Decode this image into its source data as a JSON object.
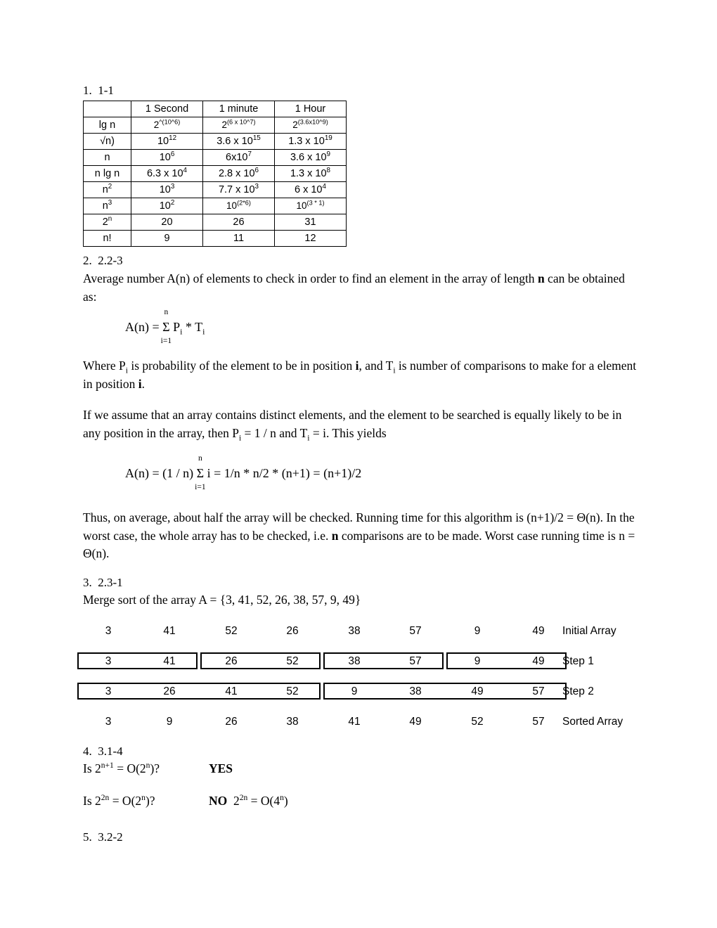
{
  "document": {
    "title_sections": [
      "1.  1-1",
      "2.  2.2-3",
      "3.  2.3-1",
      "4.  3.1-4",
      "5.  3.2-2"
    ]
  },
  "problem1": {
    "heading": "1.  1-1",
    "table": {
      "columns": [
        "",
        "1 Second",
        "1 minute",
        "1 Hour"
      ],
      "rows": [
        {
          "label": "lg n",
          "cells": [
            {
              "base": "2",
              "sup": "^(10^6)",
              "small": true
            },
            {
              "base": "2",
              "sup": "(6 x 10^7)",
              "small": true
            },
            {
              "base": "2",
              "sup": "(3.6x10^9)",
              "small": true
            }
          ]
        },
        {
          "label": "√n)",
          "cells": [
            {
              "base": "10",
              "sup": "12"
            },
            {
              "base": "3.6 x 10",
              "sup": "15"
            },
            {
              "base": "1.3 x 10",
              "sup": "19"
            }
          ]
        },
        {
          "label": "n",
          "cells": [
            {
              "base": "10",
              "sup": "6"
            },
            {
              "base": "6x10",
              "sup": "7"
            },
            {
              "base": "3.6 x 10",
              "sup": "9"
            }
          ]
        },
        {
          "label": "n lg n",
          "cells": [
            {
              "base": "6.3 x 10",
              "sup": "4"
            },
            {
              "base": "2.8 x 10",
              "sup": "6"
            },
            {
              "base": "1.3 x 10",
              "sup": "8"
            }
          ]
        },
        {
          "label": "n²",
          "label_base": "n",
          "label_sup": "2",
          "cells": [
            {
              "base": "10",
              "sup": "3"
            },
            {
              "base": "7.7 x 10",
              "sup": "3"
            },
            {
              "base": "6 x 10",
              "sup": "4"
            }
          ]
        },
        {
          "label": "n³",
          "label_base": "n",
          "label_sup": "3",
          "cells": [
            {
              "base": "10",
              "sup": "2"
            },
            {
              "base": "10",
              "sup": "(2*6)",
              "small": true
            },
            {
              "base": "10",
              "sup": "(3 * 1)",
              "small": true
            }
          ]
        },
        {
          "label": "2ⁿ",
          "label_base": "2",
          "label_sup": "n",
          "cells": [
            {
              "base": "20",
              "sup": ""
            },
            {
              "base": "26",
              "sup": ""
            },
            {
              "base": "31",
              "sup": ""
            }
          ]
        },
        {
          "label": "n!",
          "cells": [
            {
              "base": "9",
              "sup": ""
            },
            {
              "base": "11",
              "sup": ""
            },
            {
              "base": "12",
              "sup": ""
            }
          ]
        }
      ]
    }
  },
  "problem2": {
    "heading": "2.  2.2-3",
    "para1_a": "Average number A(n) of elements to check in order to find an element in the array of length ",
    "para1_bold": "n",
    "para1_b": " can be obtained as:",
    "formula1": {
      "lead": "A(n) = ",
      "sigma": "Σ",
      "upper": "n",
      "lower": "i=1",
      "tail": " P",
      "tail_sub": "i",
      "tail2": " * T",
      "tail2_sub": "i"
    },
    "para2_a": "Where P",
    "para2_sub1": "i",
    "para2_b": " is probability of the element to be in position ",
    "para2_bold1": "i",
    "para2_c": ", and T",
    "para2_sub2": "i",
    "para2_d": " is number of comparisons to make for a element in position ",
    "para2_bold2": "i",
    "para2_e": ".",
    "para3_a": "If we assume that an array contains distinct elements, and the element to be searched is equally likely to be in any position in the array, then P",
    "para3_sub1": "i",
    "para3_b": " = 1 / n and T",
    "para3_sub2": "i",
    "para3_c": " = i.  This yields",
    "formula2": {
      "lead": "A(n) = (1 / n) ",
      "sigma": "Σ",
      "upper": "n",
      "lower": "i=1",
      "tail": " i = 1/n * n/2 * (n+1) = (n+1)/2"
    },
    "para4_a": "Thus, on average, about half the array will be checked. Running time for this algorithm is (n+1)/2 = Θ(n). In the worst case, the whole array has to be checked, i.e. ",
    "para4_bold": "n",
    "para4_b": " comparisons are to be made. Worst case running time is n = Θ(n)."
  },
  "problem3": {
    "heading": "3.  2.3-1",
    "subtitle": "Merge sort of the array A = {3, 41, 52, 26, 38, 57, 9, 49}",
    "rows": [
      {
        "label": "Initial Array",
        "values": [
          "3",
          "41",
          "52",
          "26",
          "38",
          "57",
          "9",
          "49"
        ],
        "boxes": []
      },
      {
        "label": "Step 1",
        "values": [
          "3",
          "41",
          "26",
          "52",
          "38",
          "57",
          "9",
          "49"
        ],
        "boxes": [
          {
            "start": 0,
            "span": 2
          },
          {
            "start": 2,
            "span": 2
          },
          {
            "start": 4,
            "span": 2
          },
          {
            "start": 6,
            "span": 2
          }
        ]
      },
      {
        "label": "Step 2",
        "values": [
          "3",
          "26",
          "41",
          "52",
          "9",
          "38",
          "49",
          "57"
        ],
        "boxes": [
          {
            "start": 0,
            "span": 4
          },
          {
            "start": 4,
            "span": 4
          }
        ]
      },
      {
        "label": "Sorted Array",
        "values": [
          "3",
          "9",
          "26",
          "38",
          "41",
          "49",
          "52",
          "57"
        ],
        "boxes": []
      }
    ]
  },
  "problem4": {
    "heading": "4.  3.1-4",
    "q1_a": "Is 2",
    "q1_sup1": "n+1",
    "q1_b": " = O(2",
    "q1_sup2": "n",
    "q1_c": ")?",
    "a1": "YES",
    "q2_a": "Is 2",
    "q2_sup1": "2n",
    "q2_b": " = O(2",
    "q2_sup2": "n",
    "q2_c": ")?",
    "a2_bold": "NO",
    "a2_a": "  2",
    "a2_sup1": "2n",
    "a2_b": " = O(4",
    "a2_sup2": "n",
    "a2_c": ")"
  },
  "problem5": {
    "heading": "5.  3.2-2"
  }
}
